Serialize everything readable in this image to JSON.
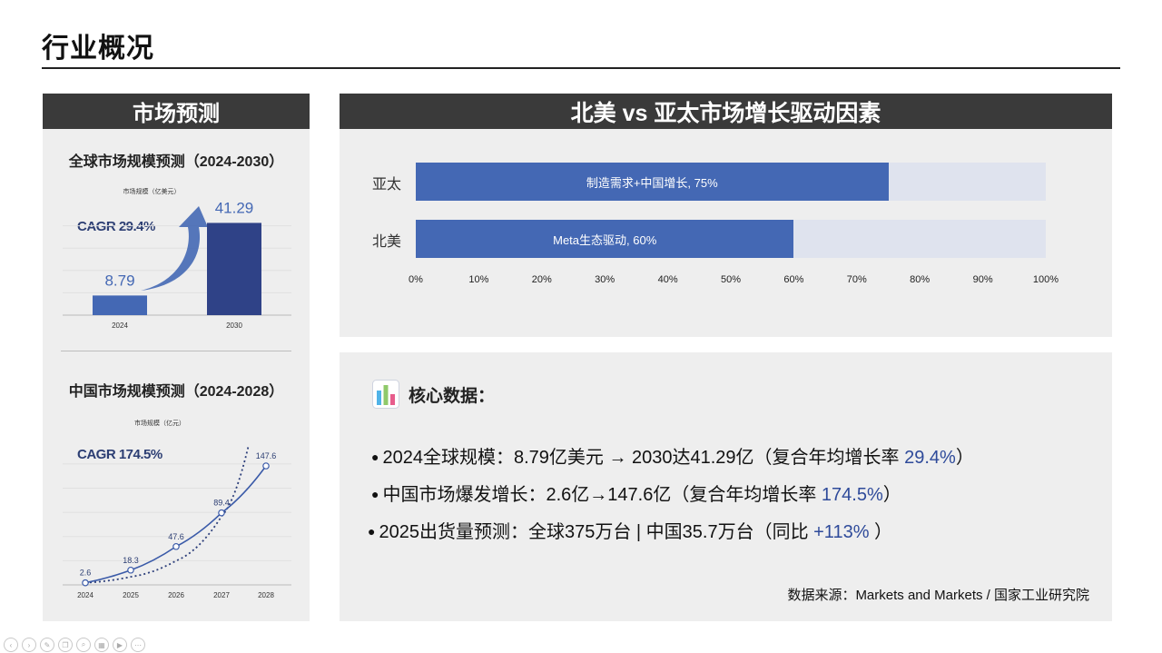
{
  "page": {
    "title": "行业概况"
  },
  "left_panel": {
    "header": "市场预测",
    "global_chart": {
      "title": "全球市场规模预测（2024-2030）",
      "unit": "市场规模（亿美元）",
      "cagr": "CAGR 29.4%"
    },
    "china_chart": {
      "title": "中国市场规模预测（2024-2028）",
      "unit": "市场规模（亿元）",
      "cagr": "CAGR 174.5%"
    }
  },
  "right_panel": {
    "header": "北美 vs 亚太市场增长驱动因素"
  },
  "chart_data": [
    {
      "type": "bar",
      "title": "全球市场规模预测（2024-2030）",
      "ylabel": "市场规模（亿美元）",
      "categories": [
        "2024",
        "2030"
      ],
      "values": [
        8.79,
        41.29
      ],
      "value_labels": [
        "8.79",
        "41.29"
      ],
      "annotation": "CAGR 29.4%",
      "colors": [
        "#4468b4",
        "#2f4287"
      ],
      "ylim": [
        0,
        50
      ],
      "grid": true
    },
    {
      "type": "line",
      "title": "中国市场规模预测（2024-2028）",
      "ylabel": "市场规模（亿元）",
      "x": [
        "2024",
        "2025",
        "2026",
        "2027",
        "2028"
      ],
      "series": [
        {
          "values": [
            2.6,
            18.3,
            47.6,
            89.4,
            147.6
          ],
          "labels": [
            "2.6",
            "18.3",
            "47.6",
            "89.4",
            "147.6"
          ],
          "style": "solid",
          "color": "#3a5aa8"
        },
        {
          "values": [
            2.6,
            10,
            30,
            85,
            230
          ],
          "style": "dotted",
          "color": "#2c3e7a"
        }
      ],
      "annotation": "CAGR 174.5%",
      "ylim": [
        0,
        160
      ],
      "grid": true
    },
    {
      "type": "bar",
      "orientation": "horizontal",
      "title": "北美 vs 亚太市场增长驱动因素",
      "categories": [
        "亚太",
        "北美"
      ],
      "values": [
        75,
        60
      ],
      "labels": [
        "制造需求+中国增长, 75%",
        "Meta生态驱动, 60%"
      ],
      "xlim": [
        0,
        100
      ],
      "xticks": [
        "0%",
        "10%",
        "20%",
        "30%",
        "40%",
        "50%",
        "60%",
        "70%",
        "80%",
        "90%",
        "100%"
      ],
      "colors": {
        "fill": "#4468b4",
        "track": "#dfe3ee"
      }
    }
  ],
  "core_data": {
    "icon": "bar-chart-icon",
    "title": "核心数据：",
    "bullets": [
      {
        "text": "2024全球规模：8.79亿美元 → 2030达41.29亿（复合年均增长率 ",
        "highlight": "29.4%",
        "suffix": "）"
      },
      {
        "text": "中国市场爆发增长：2.6亿→147.6亿（复合年均增长率 ",
        "highlight": "174.5%",
        "suffix": "）"
      },
      {
        "text": "2025出货量预测：全球375万台 | 中国35.7万台（同比 ",
        "highlight": "+113%",
        "suffix": " ）"
      }
    ],
    "source": "数据来源：Markets and Markets / 国家工业研究院"
  },
  "colors": {
    "accent": "#2e4a9a",
    "header_bg": "#3a3a3a",
    "panel_bg": "#eeeeee"
  }
}
